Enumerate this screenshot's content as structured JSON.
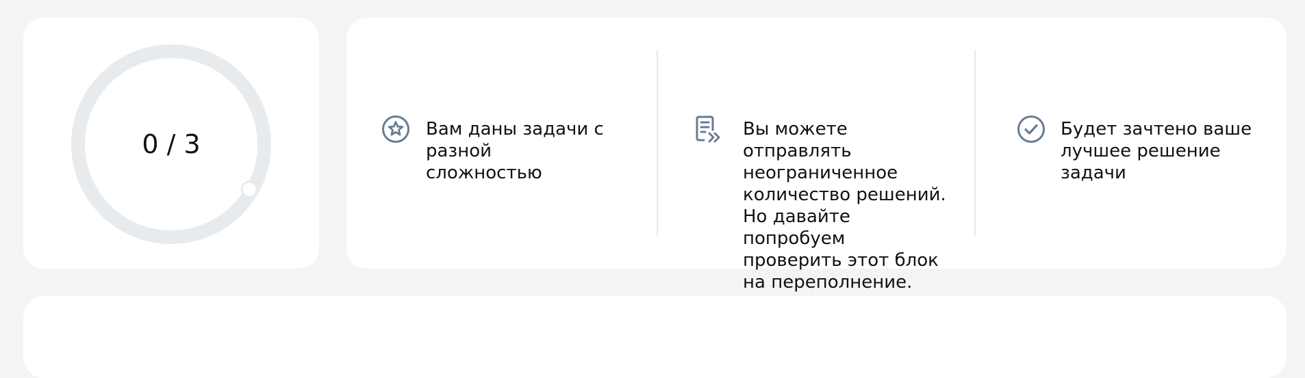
{
  "progress": {
    "solved": 0,
    "total": 3,
    "label": "0 / 3"
  },
  "info": {
    "items": [
      {
        "icon": "star-icon",
        "text": "Вам даны задачи с разной сложностью"
      },
      {
        "icon": "submit-solutions-icon",
        "text": "Вы можете отправлять неограниченное количество решений. Но давайте попробуем проверить этот блок на переполнение."
      },
      {
        "icon": "check-circle-icon",
        "text": "Будет зачтено ваше лучшее решение задачи"
      }
    ]
  },
  "colors": {
    "page_background": "#f4f4f4",
    "card_background": "#ffffff",
    "ring_track": "#e8ebee",
    "icon": "#677b93",
    "divider": "#e6e8eb",
    "text": "#111111"
  }
}
